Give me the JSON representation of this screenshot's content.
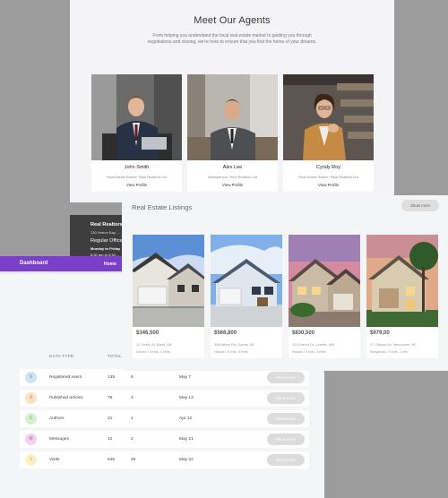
{
  "agents": {
    "title": "Meet Our Agents",
    "intro": "From helping you understand the local real estate market to guiding you through negotiations and closing, we're here to ensure that you find the home of your dreams.",
    "cards": [
      {
        "name": "John Smith",
        "role": "Real Estate Broker, Real Realtors Ltd",
        "link": "View Profile"
      },
      {
        "name": "Alex Lee",
        "role": "Salesperson, Real Realtors Ltd",
        "link": "View Profile"
      },
      {
        "name": "Cyndy Roy",
        "role": "Real Estate Broker, Real Realtors Ltd",
        "link": "View Profile"
      }
    ]
  },
  "office": {
    "name": "Real Realtors",
    "address": "130 Horton Bay, ...",
    "heading": "Regular Office",
    "hours_line1": "Monday to Friday",
    "hours_line2": "8:30 am to 4:30 ..."
  },
  "dashboard": {
    "brand": "Dashboard",
    "home": "Home",
    "col_type": "DATA TYPE",
    "col_total": "TOTAL",
    "rows": [
      {
        "badge": "U",
        "type": "Registered users",
        "total": "138",
        "count": "9",
        "date": "May 7",
        "action": "Show more",
        "color": "#cfe3f7",
        "badge_text_color": "#5a8fc8"
      },
      {
        "badge": "A",
        "type": "Published articles",
        "total": "79",
        "count": "3",
        "date": "May 13",
        "action": "Show more",
        "color": "#fbe1c7",
        "badge_text_color": "#d28a3e"
      },
      {
        "badge": "C",
        "type": "Authors",
        "total": "21",
        "count": "1",
        "date": "Apr 12",
        "action": "Show more",
        "color": "#d4f2d2",
        "badge_text_color": "#55a350"
      },
      {
        "badge": "M",
        "type": "Messages",
        "total": "12",
        "count": "2",
        "date": "May 21",
        "action": "Show more",
        "color": "#f5d1f0",
        "badge_text_color": "#b25aa7"
      },
      {
        "badge": "V",
        "type": "Visits",
        "total": "845",
        "count": "46",
        "date": "May 22",
        "action": "Show more",
        "color": "#fbf2c4",
        "badge_text_color": "#c4a733"
      }
    ]
  },
  "listings": {
    "title": "Real Estate Listings",
    "more": "Show more",
    "items": [
      {
        "price": "$346,500",
        "address": "12 Smith St, Banff, AB",
        "meta": "House / 3 bds, 2 bths"
      },
      {
        "price": "$568,800",
        "address": "355 Aldan Rd, Surrey, BC",
        "meta": "House / 4 bds, 3 bths"
      },
      {
        "price": "$830,500",
        "address": "111 Erebrk Dr, Lorette, MB",
        "meta": "House / 4 bds, 3 bths"
      },
      {
        "price": "$979,00",
        "address": "17 Gibson Av, Vancouver, BC",
        "meta": "Bungalow / 3 bds, 1 bth"
      }
    ]
  },
  "colors": {
    "accent": "#7b3fc9",
    "dark_card": "#3e3e3e",
    "panel": "#f4f5f7"
  }
}
